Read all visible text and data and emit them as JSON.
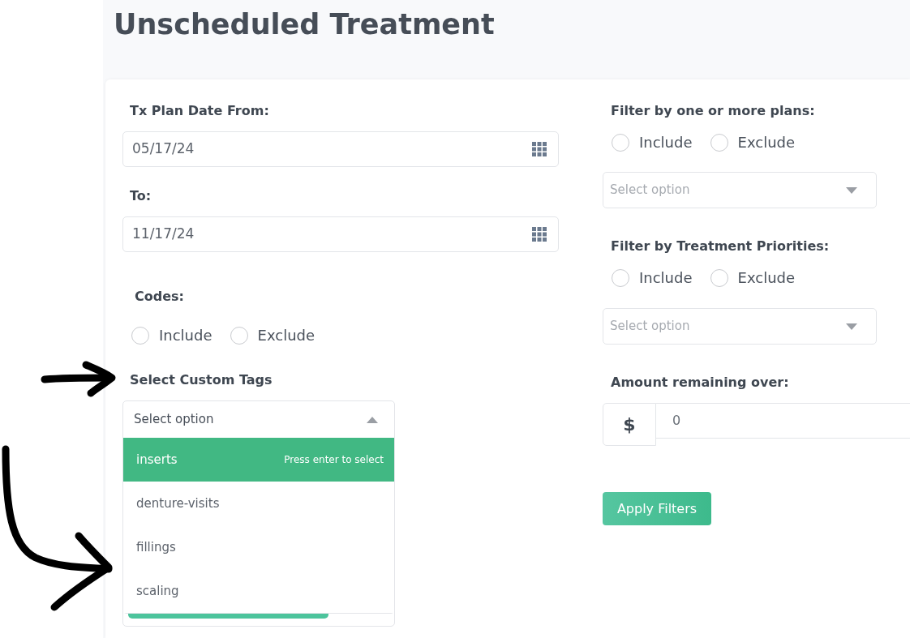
{
  "page": {
    "title": "Unscheduled Treatment"
  },
  "filters": {
    "date_from": {
      "label": "Tx Plan Date From:",
      "value": "05/17/24"
    },
    "date_to": {
      "label": "To:",
      "value": "11/17/24"
    },
    "codes": {
      "label": "Codes:",
      "options": [
        {
          "label": "Include",
          "selected": false
        },
        {
          "label": "Exclude",
          "selected": false
        }
      ]
    },
    "custom_tags": {
      "label": "Select Custom Tags",
      "placeholder": "Select option",
      "open": true,
      "options": [
        {
          "label": "inserts",
          "highlighted": true,
          "hint": "Press enter to select"
        },
        {
          "label": "denture-visits",
          "highlighted": false
        },
        {
          "label": "fillings",
          "highlighted": false
        },
        {
          "label": "scaling",
          "highlighted": false
        }
      ]
    },
    "plans": {
      "label": "Filter by one or more plans:",
      "options": [
        {
          "label": "Include",
          "selected": false
        },
        {
          "label": "Exclude",
          "selected": false
        }
      ],
      "select": {
        "placeholder": "Select option",
        "open": false
      }
    },
    "priorities": {
      "label": "Filter by Treatment Priorities:",
      "options": [
        {
          "label": "Include",
          "selected": false
        },
        {
          "label": "Exclude",
          "selected": false
        }
      ],
      "select": {
        "placeholder": "Select option",
        "open": false
      }
    },
    "amount": {
      "label": "Amount remaining over:",
      "prefix": "$",
      "value": "0"
    },
    "apply_button": "Apply Filters"
  },
  "annotations": [
    {
      "kind": "straight_arrow"
    },
    {
      "kind": "curved_arrow"
    }
  ]
}
